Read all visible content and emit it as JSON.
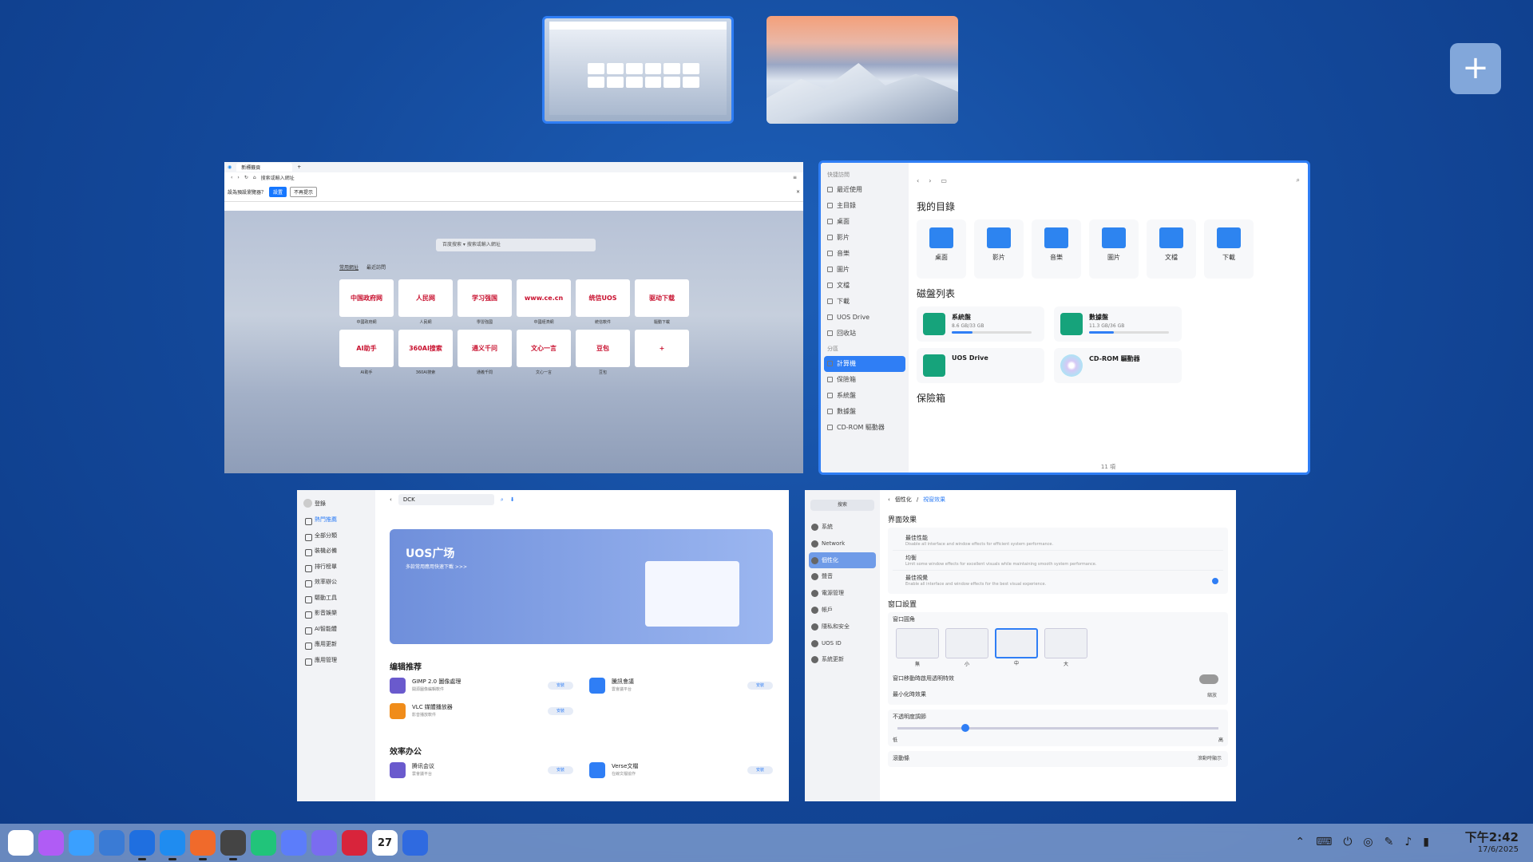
{
  "workspaces": {
    "add_label": "+"
  },
  "browser": {
    "tab_title": "新標籤頁",
    "address": "搜索或輸入網址",
    "info_text": "設為預設瀏覽器？",
    "set_default": "設置",
    "not_now": "不再提示",
    "search_engine": "百度搜索",
    "search_placeholder": "搜索或輸入網址",
    "tab_frequent": "常用網址",
    "tab_recent": "最近訪問",
    "tiles": [
      {
        "label": "中国政府网",
        "caption": "中國政府網"
      },
      {
        "label": "人民网",
        "caption": "人民網"
      },
      {
        "label": "学习强国",
        "caption": "學習強國"
      },
      {
        "label": "www.ce.cn",
        "caption": "中國經濟網"
      },
      {
        "label": "统信UOS",
        "caption": "統信軟件"
      },
      {
        "label": "驱动下载",
        "caption": "驅動下載"
      },
      {
        "label": "AI助手",
        "caption": "AI助手"
      },
      {
        "label": "360AI搜索",
        "caption": "360AI搜索"
      },
      {
        "label": "通义千问",
        "caption": "通義千問"
      },
      {
        "label": "文心一言",
        "caption": "文心一言"
      },
      {
        "label": "豆包",
        "caption": "豆包"
      },
      {
        "label": "+",
        "caption": ""
      }
    ]
  },
  "file_manager": {
    "sidebar": [
      {
        "label": "快捷訪問",
        "group": true
      },
      {
        "label": "最近使用"
      },
      {
        "label": "主目錄"
      },
      {
        "label": "桌面"
      },
      {
        "label": "影片"
      },
      {
        "label": "音樂"
      },
      {
        "label": "圖片"
      },
      {
        "label": "文檔"
      },
      {
        "label": "下載"
      },
      {
        "label": "UOS Drive"
      },
      {
        "label": "回收站"
      },
      {
        "label": "分區",
        "group": true
      },
      {
        "label": "計算機",
        "active": true
      },
      {
        "label": "保險箱"
      },
      {
        "label": "系統盤"
      },
      {
        "label": "數據盤"
      },
      {
        "label": "CD-ROM 驅動器"
      }
    ],
    "my_dirs_title": "我的目錄",
    "folders": [
      "桌面",
      "影片",
      "音樂",
      "圖片",
      "文檔",
      "下載"
    ],
    "disks_title": "磁盤列表",
    "disks": [
      {
        "name": "系統盤",
        "size": "8.6 GB/33 GB",
        "usage": 0.26
      },
      {
        "name": "數據盤",
        "size": "11.3 GB/36 GB",
        "usage": 0.31
      },
      {
        "name": "UOS Drive",
        "size": "",
        "usage": 0
      },
      {
        "name": "CD-ROM 驅動器",
        "size": "",
        "usage": 0
      }
    ],
    "vault_title": "保險箱",
    "footer": "11 項"
  },
  "store": {
    "user": "登錄",
    "sidebar": [
      "熱門推薦",
      "全部分類",
      "裝機必備",
      "排行榜單",
      "效率辦公",
      "驅動工具",
      "影音娛樂",
      "AI智能體",
      "應用更新",
      "應用管理"
    ],
    "search_value": "DCK",
    "banner_title": "UOS广场",
    "banner_sub": "多款常用應用快速下載 >>>",
    "editor_title": "编辑推荐",
    "apps_editor": [
      {
        "name": "GIMP 2.0 圖像處理",
        "desc": "開源圖像編輯軟件",
        "btn": "安裝"
      },
      {
        "name": "騰訊會議",
        "desc": "雲會議平台",
        "btn": "安裝"
      },
      {
        "name": "VLC 媒體播放器",
        "desc": "影音播放軟件",
        "btn": "安裝"
      }
    ],
    "office_title": "效率办公",
    "apps_office": [
      {
        "name": "腾讯会议",
        "desc": "雲會議平台",
        "btn": "安裝"
      },
      {
        "name": "Verse文檔",
        "desc": "在線文檔協作",
        "btn": "安裝"
      }
    ]
  },
  "settings": {
    "search": "搜索",
    "sidebar": [
      "系統",
      "Network",
      "個性化",
      "聲音",
      "電源管理",
      "帳戶",
      "隱私和安全",
      "UOS ID",
      "系統更新"
    ],
    "active_index": 2,
    "breadcrumb_parent": "個性化",
    "breadcrumb_current": "視窗效果",
    "section_effects": "界面效果",
    "effects": [
      {
        "name": "最佳性能",
        "desc": "Disable all interface and window effects for efficient system performance."
      },
      {
        "name": "均衡",
        "desc": "Limit some window effects for excellent visuals while maintaining smooth system performance."
      },
      {
        "name": "最佳視覺",
        "desc": "Enable all interface and window effects for the best visual experience."
      }
    ],
    "section_window": "窗口設置",
    "corner_label": "窗口圓角",
    "corners": [
      "無",
      "小",
      "中",
      "大"
    ],
    "corner_selected": 2,
    "transparent_move": "窗口移動時啟用透明特效",
    "minimize_effect": "最小化時效果",
    "minimize_value": "縮放",
    "opacity_label": "不透明度調節",
    "opacity_low": "低",
    "opacity_high": "高",
    "opacity_value": 0.2,
    "scrollbar_label": "滾動條",
    "scrollbar_value": "滾動時顯示"
  },
  "dock": {
    "time": "下午2:42",
    "date": "17/6/2025",
    "calendar_day": "27",
    "apps": [
      {
        "name": "launcher",
        "color": "#ffffff"
      },
      {
        "name": "ai",
        "color": "#b05cf5"
      },
      {
        "name": "search",
        "color": "#3aa0ff"
      },
      {
        "name": "multitask",
        "color": "#3a7bd5"
      },
      {
        "name": "file-manager",
        "color": "#1f6fe0",
        "open": true
      },
      {
        "name": "browser",
        "color": "#1f8cf0",
        "open": true
      },
      {
        "name": "app-store",
        "color": "#f06a2b",
        "open": true
      },
      {
        "name": "settings",
        "color": "#444444",
        "open": true
      },
      {
        "name": "music",
        "color": "#21c47a"
      },
      {
        "name": "notes",
        "color": "#5c7dfa"
      },
      {
        "name": "mail",
        "color": "#7a6cf0"
      },
      {
        "name": "terminal",
        "color": "#d8243b"
      },
      {
        "name": "calendar",
        "color": "#ffffff"
      },
      {
        "name": "phone",
        "color": "#2f6ae0"
      }
    ]
  }
}
